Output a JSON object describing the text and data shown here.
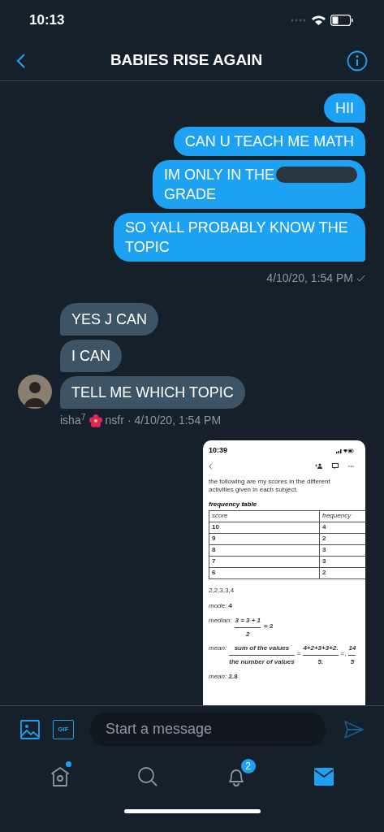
{
  "status_bar": {
    "time": "10:13"
  },
  "header": {
    "title": "BABIES RISE AGAIN"
  },
  "outgoing": {
    "messages": [
      {
        "kind": "text",
        "text": "HII"
      },
      {
        "kind": "text",
        "text": "CAN U TEACH ME MATH"
      },
      {
        "kind": "redacted",
        "before": "IM ONLY IN THE",
        "after": "GRADE"
      },
      {
        "kind": "text",
        "text": "SO YALL PROBABLY KNOW THE TOPIC"
      }
    ],
    "timestamp": "4/10/20, 1:54 PM",
    "read": true
  },
  "incoming": {
    "messages": [
      {
        "text": "YES J CAN"
      },
      {
        "text": "I CAN"
      },
      {
        "text": "TELL ME WHICH TOPIC"
      }
    ],
    "sender": "isha$^{7}$",
    "sender_suffix": "nsfr",
    "timestamp": "· 4/10/20, 1:54 PM"
  },
  "attachment": {
    "time": "10:39",
    "intro": "the following are my scores in the different activities given in each subject.",
    "table_title": "frequency table",
    "columns": [
      "score",
      "frequency"
    ],
    "rows": [
      [
        "10",
        "4"
      ],
      [
        "9",
        "2"
      ],
      [
        "8",
        "3"
      ],
      [
        "7",
        "3"
      ],
      [
        "6",
        "2"
      ]
    ],
    "list": "2,2,3,3,4",
    "mode": "*mode:* **4**",
    "median": {
      "label": "median:",
      "numerator": "3 = 3 + 1",
      "denominator": "2",
      "result": "= 2"
    },
    "mean_formula": {
      "label": "mean:",
      "numerator": "sum of the values",
      "denominator": "the number of values",
      "eq1": "=",
      "numerator2": "4+2+3+3+2.",
      "denominator2": "5.",
      "eq2": "=,",
      "numerator3": "14",
      "denominator3": "5"
    },
    "mean": "*mean:* **2.8**"
  },
  "composer": {
    "placeholder": "Start a message",
    "gif_label": "GIF"
  },
  "nav": [
    {
      "kind": "home",
      "selected": false,
      "dot": true
    },
    {
      "kind": "search",
      "selected": false
    },
    {
      "kind": "notifications",
      "selected": false,
      "badge": "2"
    },
    {
      "kind": "messages",
      "selected": true
    }
  ]
}
